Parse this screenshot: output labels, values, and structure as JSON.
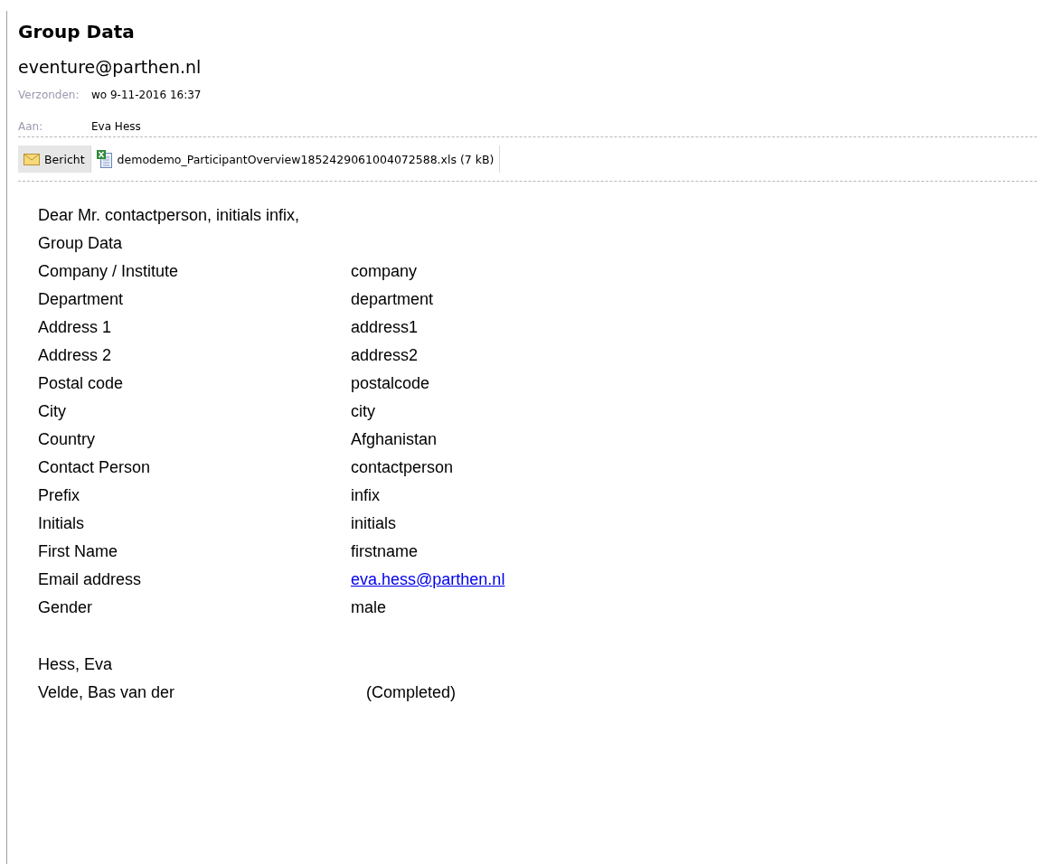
{
  "header": {
    "subject": "Group Data",
    "sender": "eventure@parthen.nl",
    "meta": [
      {
        "label": "Verzonden:",
        "value": "wo 9-11-2016 16:37"
      },
      {
        "label": "Aan:",
        "value": "Eva Hess"
      }
    ]
  },
  "attachments": [
    {
      "kind": "message",
      "label": "Bericht",
      "selected": true
    },
    {
      "kind": "excel",
      "label": "demodemo_ParticipantOverview1852429061004072588.xls (7 kB)",
      "selected": false
    }
  ],
  "body": {
    "greeting": "Dear Mr. contactperson, initials infix,",
    "section_title": "Group Data",
    "fields": [
      {
        "label": "Company / Institute",
        "value": "company",
        "kind": "text"
      },
      {
        "label": "Department",
        "value": "department",
        "kind": "text"
      },
      {
        "label": "Address 1",
        "value": "address1",
        "kind": "text"
      },
      {
        "label": "Address 2",
        "value": "address2",
        "kind": "text"
      },
      {
        "label": "Postal code",
        "value": "postalcode",
        "kind": "text"
      },
      {
        "label": "City",
        "value": "city",
        "kind": "text"
      },
      {
        "label": "Country",
        "value": "Afghanistan",
        "kind": "text"
      },
      {
        "label": "Contact Person",
        "value": "contactperson",
        "kind": "text"
      },
      {
        "label": "Prefix",
        "value": "infix",
        "kind": "text"
      },
      {
        "label": "Initials",
        "value": "initials",
        "kind": "text"
      },
      {
        "label": "First Name",
        "value": "firstname",
        "kind": "text"
      },
      {
        "label": "Email address",
        "value": "eva.hess@parthen.nl",
        "kind": "link"
      },
      {
        "label": "Gender",
        "value": "male",
        "kind": "text"
      }
    ],
    "participants": [
      {
        "name": "Hess, Eva"
      },
      {
        "name": "Velde, Bas van der",
        "status": "(Completed)"
      }
    ]
  }
}
